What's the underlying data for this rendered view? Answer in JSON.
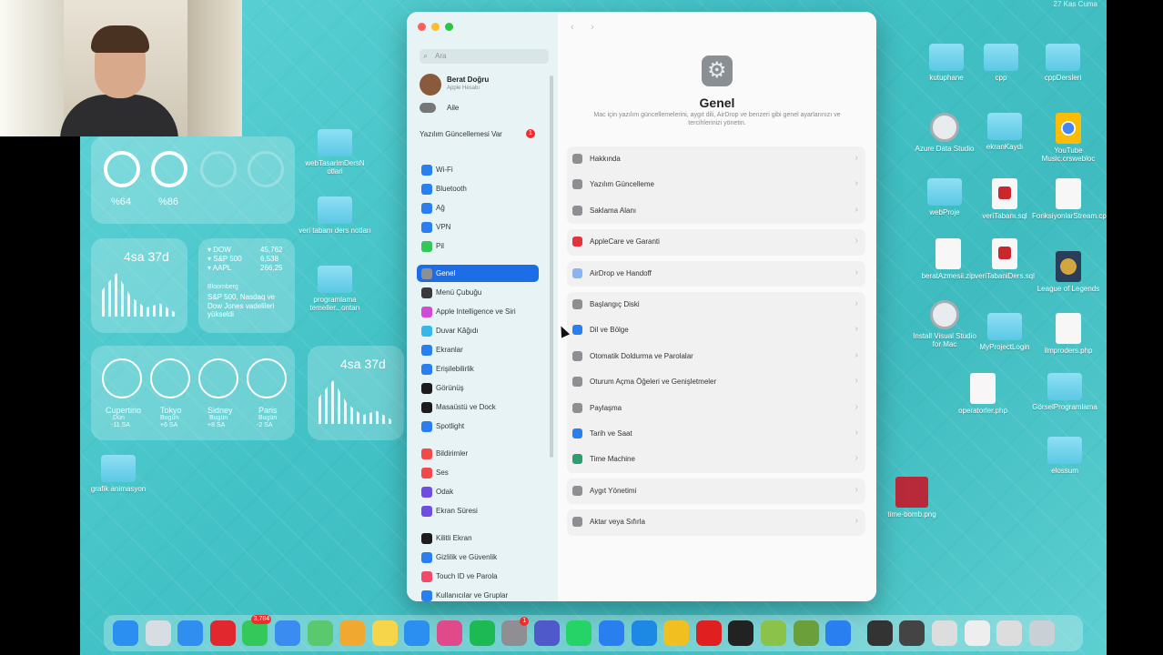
{
  "widgets": {
    "battery": {
      "mac_pct": "%64",
      "mouse_pct": "%86"
    },
    "screentime": {
      "value": "4sa 37d"
    },
    "screentime2": {
      "value": "4sa 37d"
    },
    "stocks": {
      "rows": [
        {
          "sym": "▾ DOW",
          "val": "45,762"
        },
        {
          "sym": "▾ S&P 500",
          "val": "6,538"
        },
        {
          "sym": "▾ AAPL",
          "val": "266,25"
        }
      ],
      "headline_source": "Bloomberg",
      "headline": "S&P 500, Nasdaq ve Dow Jones vadelileri yükseldi"
    },
    "clocks": [
      {
        "city": "Cupertino",
        "sub": "Dün",
        "offset": "-11 SA"
      },
      {
        "city": "Tokyo",
        "sub": "Bugün",
        "offset": "+6 SA"
      },
      {
        "city": "Sidney",
        "sub": "Bugün",
        "offset": "+8 SA"
      },
      {
        "city": "Paris",
        "sub": "Bugün",
        "offset": "-2 SA"
      }
    ]
  },
  "desktop_left": [
    {
      "label": "webTasarimDersN otlari"
    },
    {
      "label": "veri tabanı ders notları"
    },
    {
      "label": "programlama temeller...ontarı"
    },
    {
      "label": "grafik animasyon"
    }
  ],
  "desktop_right": [
    {
      "label": "kutuphane",
      "kind": "folder"
    },
    {
      "label": "cpp",
      "kind": "folder"
    },
    {
      "label": "cppDersleri",
      "kind": "folder"
    },
    {
      "label": "Azure Data Studio",
      "kind": "blocked"
    },
    {
      "label": "ekranKaydı",
      "kind": "folder"
    },
    {
      "label": "YouTube Music.crswebloc",
      "kind": "chrome"
    },
    {
      "label": "webProje",
      "kind": "folder"
    },
    {
      "label": "veriTabanı.sql",
      "kind": "red"
    },
    {
      "label": "FonksiyonlarStream.cpp",
      "kind": "doc"
    },
    {
      "label": "beratAzmesii.zip",
      "kind": "doc"
    },
    {
      "label": "veriTabaniDers.sql",
      "kind": "red"
    },
    {
      "label": "League of Legends",
      "kind": "game"
    },
    {
      "label": "Install Visual Studio for Mac",
      "kind": "blocked"
    },
    {
      "label": "MyProjectLogin",
      "kind": "folder"
    },
    {
      "label": "ilmproders.php",
      "kind": "doc"
    },
    {
      "label": "operatorler.php",
      "kind": "doc"
    },
    {
      "label": "GörselProgramlama",
      "kind": "folder"
    },
    {
      "label": "elossum",
      "kind": "folder"
    },
    {
      "label": "time-bomb.png",
      "kind": "image"
    }
  ],
  "settings": {
    "search_placeholder": "Ara",
    "user_name": "Berat Doğru",
    "user_sub": "Apple Hesabı",
    "family": "Aile",
    "update_label": "Yazılım Güncellemesi Var",
    "update_badge": "1",
    "sidebar": [
      {
        "label": "Wi-Fi",
        "color": "#2a7ff0"
      },
      {
        "label": "Bluetooth",
        "color": "#2a7ff0"
      },
      {
        "label": "Ağ",
        "color": "#2a7ff0"
      },
      {
        "label": "VPN",
        "color": "#2a7ff0"
      },
      {
        "label": "Pil",
        "color": "#34c759"
      },
      {
        "label": "Genel",
        "color": "#8e8e93"
      },
      {
        "label": "Menü Çubuğu",
        "color": "#3a3a3c"
      },
      {
        "label": "Apple Intelligence ve Siri",
        "color": "#d14ad6"
      },
      {
        "label": "Duvar Kâğıdı",
        "color": "#35b7e8"
      },
      {
        "label": "Ekranlar",
        "color": "#2a7ff0"
      },
      {
        "label": "Erişilebilirlik",
        "color": "#2a7ff0"
      },
      {
        "label": "Görünüş",
        "color": "#1c1c1e"
      },
      {
        "label": "Masaüstü ve Dock",
        "color": "#1c1c1e"
      },
      {
        "label": "Spotlight",
        "color": "#2a7ff0"
      },
      {
        "label": "Bildirimler",
        "color": "#f04a4a"
      },
      {
        "label": "Ses",
        "color": "#f04a4a"
      },
      {
        "label": "Odak",
        "color": "#6e4de0"
      },
      {
        "label": "Ekran Süresi",
        "color": "#6e4de0"
      },
      {
        "label": "Kilitli Ekran",
        "color": "#1c1c1e"
      },
      {
        "label": "Gizlilik ve Güvenlik",
        "color": "#2a7ff0"
      },
      {
        "label": "Touch ID ve Parola",
        "color": "#f04a6a"
      },
      {
        "label": "Kullanıcılar ve Gruplar",
        "color": "#2a7ff0"
      }
    ],
    "active_item": "Genel",
    "main_title": "Genel",
    "main_desc": "Mac için yazılım güncellemelerini, aygıt dili, AirDrop ve benzeri gibi genel ayarlarınızı ve tercihlerinizi yönetin.",
    "rows": [
      {
        "label": "Hakkında",
        "color": "#8e8e93"
      },
      {
        "label": "Yazılım Güncelleme",
        "color": "#8e8e93"
      },
      {
        "label": "Saklama Alanı",
        "color": "#8e8e93"
      },
      {
        "label": "AppleCare ve Garanti",
        "color": "#e0343a"
      },
      {
        "label": "AirDrop ve Handoff",
        "color": "#8ab4f0"
      },
      {
        "label": "Başlangıç Diski",
        "color": "#8e8e93"
      },
      {
        "label": "Dil ve Bölge",
        "color": "#2a7ff0"
      },
      {
        "label": "Otomatik Doldurma ve Parolalar",
        "color": "#8e8e93"
      },
      {
        "label": "Oturum Açma Öğeleri ve Genişletmeler",
        "color": "#8e8e93"
      },
      {
        "label": "Paylaşma",
        "color": "#8e8e93"
      },
      {
        "label": "Tarih ve Saat",
        "color": "#2a7ff0"
      },
      {
        "label": "Time Machine",
        "color": "#2f9e6e"
      },
      {
        "label": "Aygıt Yönetimi",
        "color": "#8e8e93"
      },
      {
        "label": "Aktar veya Sıfırla",
        "color": "#8e8e93"
      }
    ]
  },
  "dock": {
    "apps": [
      {
        "name": "finder-icon",
        "color": "#2a8ff0"
      },
      {
        "name": "launchpad-icon",
        "color": "#d8dde3"
      },
      {
        "name": "safari-icon",
        "color": "#2f8ef0"
      },
      {
        "name": "opera-icon",
        "color": "#e0282e"
      },
      {
        "name": "messages-icon",
        "color": "#34c759"
      },
      {
        "name": "mail-icon",
        "color": "#3a8cf0"
      },
      {
        "name": "maps-icon",
        "color": "#5ac86e"
      },
      {
        "name": "photos-icon",
        "color": "#f0a830"
      },
      {
        "name": "notes-icon",
        "color": "#f7d54a"
      },
      {
        "name": "appstore-icon",
        "color": "#2a8ff0"
      },
      {
        "name": "instagram-icon",
        "color": "#e04a8a"
      },
      {
        "name": "spotify-icon",
        "color": "#1db954"
      },
      {
        "name": "settings-icon",
        "color": "#8e8e93"
      },
      {
        "name": "teams-icon",
        "color": "#5059c9"
      },
      {
        "name": "whatsapp-icon",
        "color": "#25d366"
      },
      {
        "name": "xcode-icon",
        "color": "#2a7ff0"
      },
      {
        "name": "vscode-icon",
        "color": "#1e88e5"
      },
      {
        "name": "chrome-icon",
        "color": "#f0c020"
      },
      {
        "name": "youtube-icon",
        "color": "#e02020"
      },
      {
        "name": "obs-icon",
        "color": "#222222"
      },
      {
        "name": "bluestacks-icon",
        "color": "#8bc34a"
      },
      {
        "name": "minecraft-icon",
        "color": "#6a9f3a"
      },
      {
        "name": "screensharing-icon",
        "color": "#2a7ff0"
      },
      {
        "name": "screenshot-1-icon",
        "color": "#333333"
      },
      {
        "name": "screenshot-2-icon",
        "color": "#444444"
      },
      {
        "name": "screenshot-3-icon",
        "color": "#dddddd"
      },
      {
        "name": "screenshot-4-icon",
        "color": "#eeeeee"
      },
      {
        "name": "screenshot-5-icon",
        "color": "#dddddd"
      },
      {
        "name": "trash-icon",
        "color": "#c9d1d6"
      }
    ],
    "messages_badge": "3,784",
    "settings_badge": "1"
  },
  "menubar_date": "27 Kas Cuma"
}
